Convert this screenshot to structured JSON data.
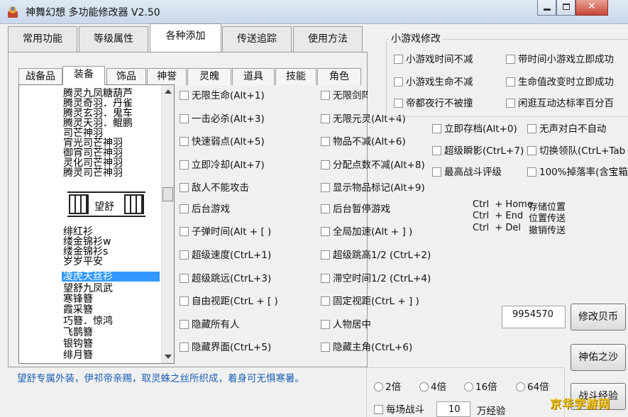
{
  "window": {
    "title": "神舞幻想 多功能修改器  V2.50"
  },
  "main_tabs": [
    "常用功能",
    "等级属性",
    "各种添加",
    "传送追踪",
    "使用方法"
  ],
  "sub_tabs": [
    "战备品",
    "装备",
    "饰品",
    "神誉",
    "灵魄",
    "道具",
    "技能",
    "角色"
  ],
  "list_items": [
    "腾灵九凤糖葫芦",
    "腾灵奇羽．丹雀",
    "腾灵玄羽．鬼车",
    "腾灵天羽．鲲鹏",
    "司芒神羽",
    "宵光司芒神羽",
    "御宵司芒神羽",
    "灵化司芒神羽",
    "腾灵司芒神羽",
    "绯红衫",
    "缕金锦衫w",
    "缕金锦衫s",
    "岁岁平安",
    "凌虎天丝衫",
    "望舒九凤武",
    "寒锋簪",
    "霞采簪",
    "巧簪．惊鸿",
    "飞鹊簪",
    "银钩簪",
    "绯月簪"
  ],
  "list_image_text": "望舒",
  "description": "望舒专属外装，伊祁帝亲赐，取灵蛛之丝所织成，着身可无惧寒暑。",
  "options_col1": [
    "无限生命(Alt+1)",
    "一击必杀(Alt+3)",
    "快速弱点(Alt+5)",
    "立即冷却(Alt+7)",
    "敌人不能攻击",
    "后台游戏",
    "子弹时间(Alt + [ )",
    "超级速度(CtrL+1)",
    "超级跳远(CtrL+3)",
    "自由视距(CtrL + [ )",
    "隐藏所有人",
    "隐藏界面(CtrL+5)"
  ],
  "options_col2": [
    "无限剑阵(Al",
    "无限元灵(Alt+4)",
    "物品不减(Alt+6)",
    "分配点数不减(Alt+8)",
    "显示物品标记(Alt+9)",
    "后台暂停游戏",
    "全局加速(Alt + ] )",
    "超级跳高1/2 (CtrL+2)",
    "滞空时间1/2 (CtrL+4)",
    "固定视距(CtrL + ] )",
    "人物居中",
    "隐藏主角(CtrL+6)"
  ],
  "minigame": {
    "label": "小游戏修改",
    "left": [
      "小游戏时间不减",
      "小游戏生命不减",
      "帝都夜行不被撞"
    ],
    "right": [
      "带时间小游戏立即成功",
      "生命值改变时立即成功",
      "闲逛互动达标率百分百"
    ]
  },
  "extra_row1": [
    "立即存档(Alt+0)",
    "无声对白不自动"
  ],
  "extra_row2": [
    "超级瞬影(CtrL+7)",
    "切换领队(CtrL+Tab"
  ],
  "extra_row3": [
    "最高战斗评级",
    "100%掉落率(含宝箱"
  ],
  "hotkeys": [
    {
      "key": "Ctrl  + Home",
      "action": "存储位置"
    },
    {
      "key": "Ctrl  + End",
      "action": "位置传送"
    },
    {
      "key": "Ctrl  + Del",
      "action": "撤销传送"
    }
  ],
  "money_value": "9954570",
  "buttons": {
    "money": "修改贝币",
    "shrine": "神佑之沙",
    "exp": "战斗经验"
  },
  "radios": [
    "2倍",
    "4倍",
    "16倍",
    "64倍"
  ],
  "exp_row": {
    "label": "每场战斗",
    "value": "10",
    "unit": "万经验"
  },
  "watermark": "京华学游网"
}
